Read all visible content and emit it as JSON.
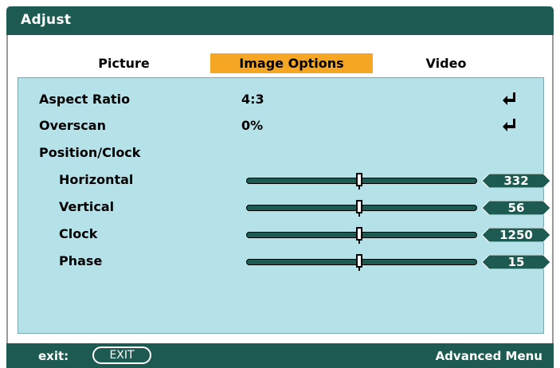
{
  "window": {
    "title": "Adjust"
  },
  "tabs": [
    {
      "label": "Picture",
      "active": false
    },
    {
      "label": "Image Options",
      "active": true
    },
    {
      "label": "Video",
      "active": false
    }
  ],
  "rows": {
    "aspect_ratio": {
      "label": "Aspect Ratio",
      "value": "4:3"
    },
    "overscan": {
      "label": "Overscan",
      "value": "0%"
    },
    "position_clock": {
      "label": "Position/Clock"
    },
    "horizontal": {
      "label": "Horizontal",
      "value": "332",
      "level": 0.5
    },
    "vertical": {
      "label": "Vertical",
      "value": "56",
      "level": 0.5
    },
    "clock": {
      "label": "Clock",
      "value": "1250",
      "level": 0.5
    },
    "phase": {
      "label": "Phase",
      "value": "15",
      "level": 0.5
    }
  },
  "footer": {
    "exit_label": "exit:",
    "exit_key": "EXIT",
    "advanced_menu": "Advanced Menu"
  },
  "colors": {
    "header": "#1d5a52",
    "tab_active": "#f5a623",
    "panel": "#b5e1e9"
  },
  "icons": {
    "enter": "enter-return-arrow-icon"
  }
}
